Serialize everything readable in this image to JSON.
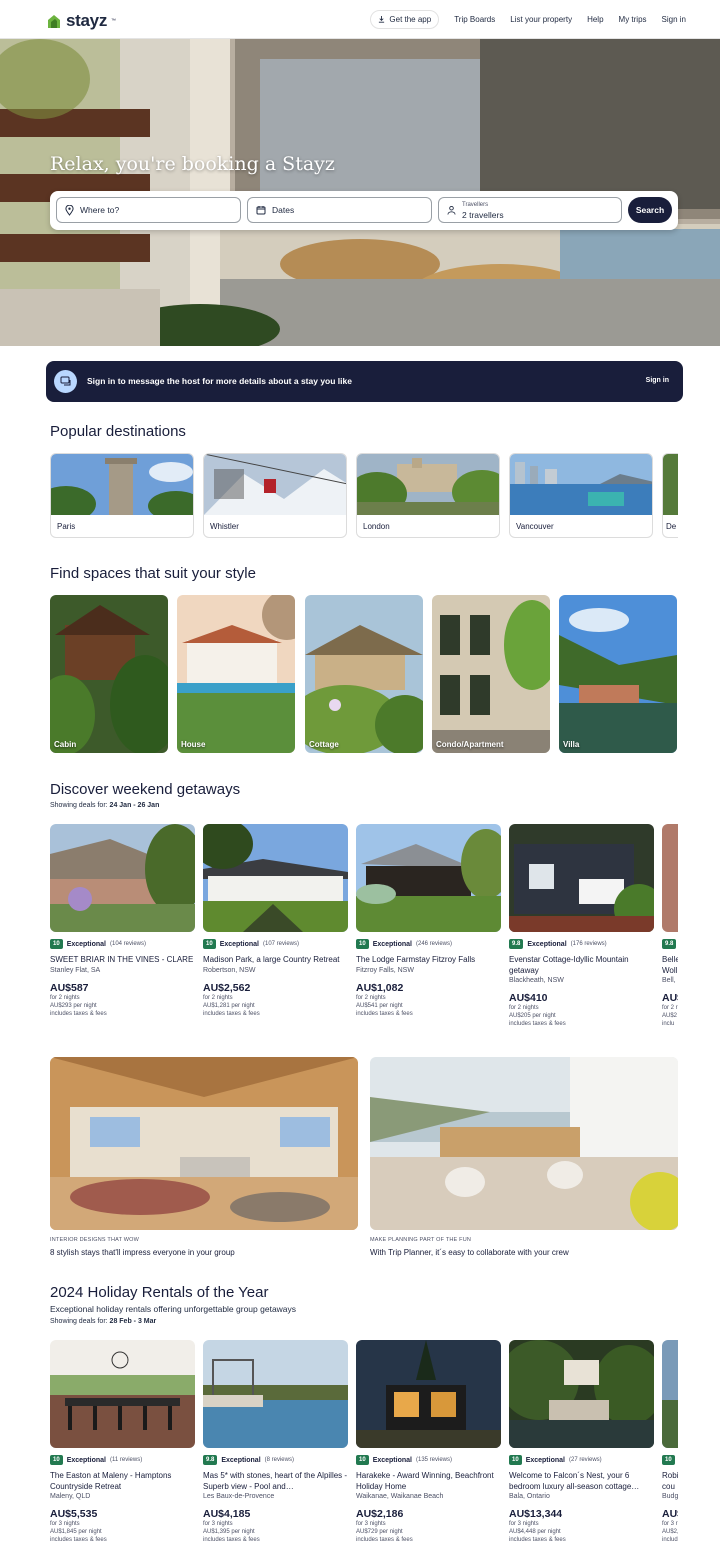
{
  "header": {
    "logo": "stayz",
    "logo_tm": "™",
    "nav": [
      "Get the app",
      "Trip Boards",
      "List your property",
      "Help",
      "My trips",
      "Sign in"
    ]
  },
  "hero": {
    "title": "Relax, you're booking a Stayz",
    "where_placeholder": "Where to?",
    "dates_placeholder": "Dates",
    "travellers_label": "Travellers",
    "travellers_value": "2 travellers",
    "search_label": "Search"
  },
  "banner": {
    "text": "Sign in to message the host for more details about a stay you like",
    "link": "Sign in"
  },
  "destinations": {
    "title": "Popular destinations",
    "items": [
      "Paris",
      "Whistler",
      "London",
      "Vancouver",
      "De"
    ]
  },
  "styles": {
    "title": "Find spaces that suit your style",
    "items": [
      "Cabin",
      "House",
      "Cottage",
      "Condo/Apartment",
      "Villa"
    ]
  },
  "getaways": {
    "title": "Discover weekend getaways",
    "deals_prefix": "Showing deals for:",
    "deals_dates": "24 Jan - 26 Jan",
    "items": [
      {
        "score": "10",
        "word": "Exceptional",
        "reviews": "(104 reviews)",
        "name": "SWEET BRIAR IN THE VINES - CLARE",
        "loc": "Stanley Flat, SA",
        "price": "AU$587",
        "nights": "for 2 nights",
        "per": "AU$293 per night",
        "tax": "includes taxes & fees"
      },
      {
        "score": "10",
        "word": "Exceptional",
        "reviews": "(107 reviews)",
        "name": "Madison Park, a large Country Retreat",
        "loc": "Robertson, NSW",
        "price": "AU$2,562",
        "nights": "for 2 nights",
        "per": "AU$1,281 per night",
        "tax": "includes taxes & fees"
      },
      {
        "score": "10",
        "word": "Exceptional",
        "reviews": "(246 reviews)",
        "name": "The Lodge Farmstay Fitzroy Falls",
        "loc": "Fitzroy Falls, NSW",
        "price": "AU$1,082",
        "nights": "for 2 nights",
        "per": "AU$541 per night",
        "tax": "includes taxes & fees"
      },
      {
        "score": "9.8",
        "word": "Exceptional",
        "reviews": "(176 reviews)",
        "name": "Evenstar Cottage-Idyllic Mountain getaway",
        "loc": "Blackheath, NSW",
        "price": "AU$410",
        "nights": "for 2 nights",
        "per": "AU$205 per night",
        "tax": "includes taxes & fees"
      },
      {
        "score": "9.8",
        "word": "",
        "reviews": "",
        "name": "Belle Woll",
        "loc": "Bell,",
        "price": "AU$",
        "nights": "for 2 r",
        "per": "AU$2",
        "tax": "inclu"
      }
    ]
  },
  "features": [
    {
      "kicker": "INTERIOR DESIGNS THAT WOW",
      "title": "8 stylish stays that'll impress everyone in your group"
    },
    {
      "kicker": "MAKE PLANNING PART OF THE FUN",
      "title": "With Trip Planner, it´s easy to collaborate with your crew"
    }
  ],
  "holiday": {
    "title": "2024 Holiday Rentals of the Year",
    "subtitle": "Exceptional holiday rentals offering unforgettable group getaways",
    "deals_prefix": "Showing deals for:",
    "deals_dates": "28 Feb - 3 Mar",
    "items": [
      {
        "score": "10",
        "word": "Exceptional",
        "reviews": "(11 reviews)",
        "name": "The Easton at Maleny - Hamptons Countryside Retreat",
        "loc": "Maleny, QLD",
        "price": "AU$5,535",
        "nights": "for 3 nights",
        "per": "AU$1,845 per night",
        "tax": "includes taxes & fees"
      },
      {
        "score": "9.8",
        "word": "Exceptional",
        "reviews": "(8 reviews)",
        "name": "Mas 5* with stones, heart of the Alpilles - Superb view - Pool and…",
        "loc": "Les Baux-de-Provence",
        "price": "AU$4,185",
        "nights": "for 3 nights",
        "per": "AU$1,395 per night",
        "tax": "includes taxes & fees"
      },
      {
        "score": "10",
        "word": "Exceptional",
        "reviews": "(135 reviews)",
        "name": "Harakeke - Award Winning, Beachfront Holiday Home",
        "loc": "Waikanae, Waikanae Beach",
        "price": "AU$2,186",
        "nights": "for 3 nights",
        "per": "AU$729 per night",
        "tax": "includes taxes & fees"
      },
      {
        "score": "10",
        "word": "Exceptional",
        "reviews": "(27 reviews)",
        "name": "Welcome to Falcon´s Nest, your 6 bedroom luxury all-season cottage…",
        "loc": "Bala, Ontario",
        "price": "AU$13,344",
        "nights": "for 3 nights",
        "per": "AU$4,448 per night",
        "tax": "includes taxes & fees"
      },
      {
        "score": "10",
        "word": "",
        "reviews": "",
        "name": "Robi cou",
        "loc": "Budg",
        "price": "AU$",
        "nights": "for 3 r",
        "per": "AU$2,",
        "tax": "includ"
      }
    ]
  },
  "colors": {
    "navy": "#191e3b",
    "badge_green": "#227950",
    "banner_icon_bg": "#b9d7ff"
  }
}
